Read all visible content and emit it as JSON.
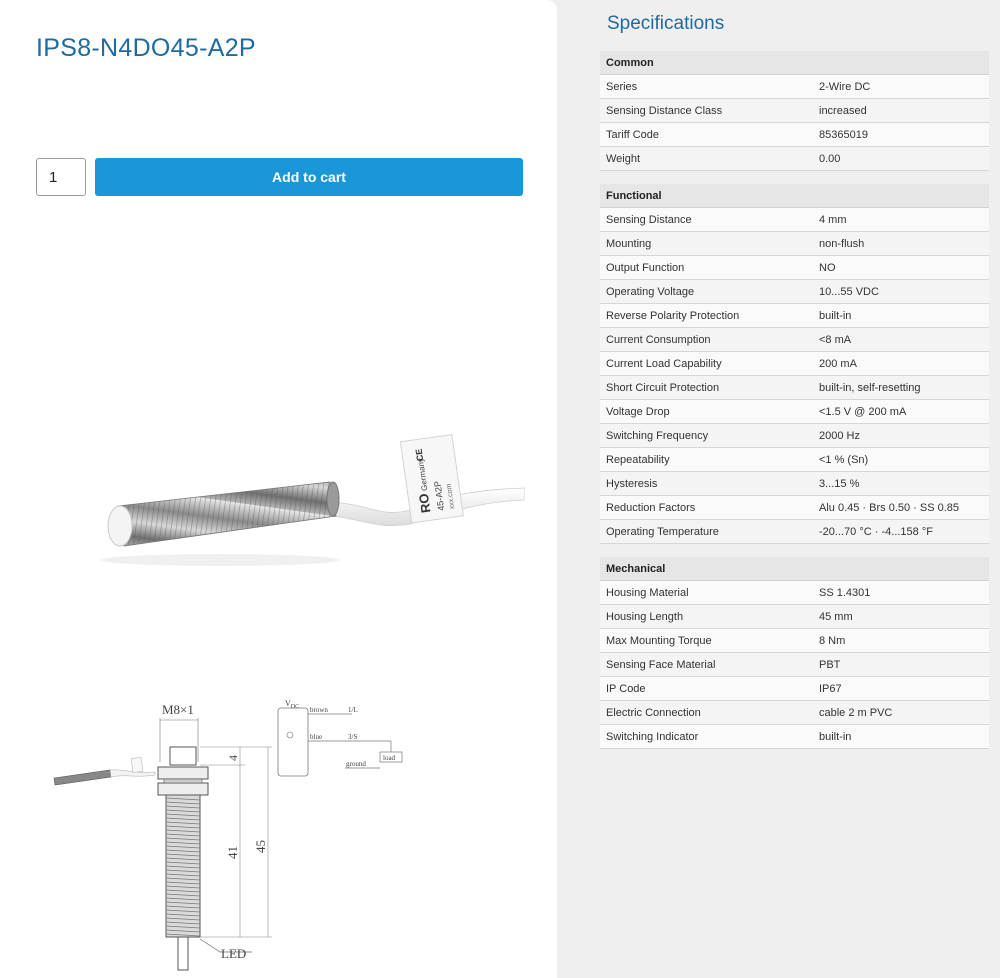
{
  "product": {
    "title": "IPS8-N4DO45-A2P",
    "quantity": "1",
    "add_to_cart_label": "Add to cart"
  },
  "photo": {
    "label_brand": "RO",
    "label_country": "Germany",
    "label_ce": "CE",
    "label_model": "45-A2P",
    "label_web": "xxx.com"
  },
  "drawing": {
    "thread": "M8×1",
    "dim_4": "4",
    "dim_41": "41",
    "dim_45": "45",
    "led": "LED",
    "vdc": "V",
    "vdc_sub": "DC",
    "wire_brown": "brown",
    "wire_blue": "blue",
    "wire_ground": "ground",
    "pin_1": "1/L",
    "pin_3": "3/S",
    "load": "load"
  },
  "specs": {
    "title": "Specifications",
    "common": {
      "heading": "Common",
      "rows": [
        {
          "k": "Series",
          "v": "2-Wire DC"
        },
        {
          "k": "Sensing Distance Class",
          "v": "increased"
        },
        {
          "k": "Tariff Code",
          "v": "85365019"
        },
        {
          "k": "Weight",
          "v": "0.00"
        }
      ]
    },
    "functional": {
      "heading": "Functional",
      "rows": [
        {
          "k": "Sensing Distance",
          "v": "4 mm"
        },
        {
          "k": "Mounting",
          "v": "non-flush"
        },
        {
          "k": "Output Function",
          "v": "NO"
        },
        {
          "k": "Operating Voltage",
          "v": "10...55 VDC"
        },
        {
          "k": "Reverse Polarity Protection",
          "v": "built-in"
        },
        {
          "k": "Current Consumption",
          "v": "<8 mA"
        },
        {
          "k": "Current Load Capability",
          "v": "200 mA"
        },
        {
          "k": "Short Circuit Protection",
          "v": "built-in, self-resetting"
        },
        {
          "k": "Voltage Drop",
          "v": "<1.5 V @ 200 mA"
        },
        {
          "k": "Switching Frequency",
          "v": "2000 Hz"
        },
        {
          "k": "Repeatability",
          "v": "<1 % (Sn)"
        },
        {
          "k": "Hysteresis",
          "v": "3...15 %"
        },
        {
          "k": "Reduction Factors",
          "v": "Alu 0.45 · Brs 0.50 · SS 0.85"
        },
        {
          "k": "Operating Temperature",
          "v": "-20...70 °C · -4...158 °F"
        }
      ]
    },
    "mechanical": {
      "heading": "Mechanical",
      "rows": [
        {
          "k": "Housing Material",
          "v": "SS 1.4301"
        },
        {
          "k": "Housing Length",
          "v": "45 mm"
        },
        {
          "k": "Max Mounting Torque",
          "v": "8 Nm"
        },
        {
          "k": "Sensing Face Material",
          "v": "PBT"
        },
        {
          "k": "IP Code",
          "v": "IP67"
        },
        {
          "k": "Electric Connection",
          "v": "cable 2 m PVC"
        },
        {
          "k": "Switching Indicator",
          "v": "built-in"
        }
      ]
    }
  }
}
